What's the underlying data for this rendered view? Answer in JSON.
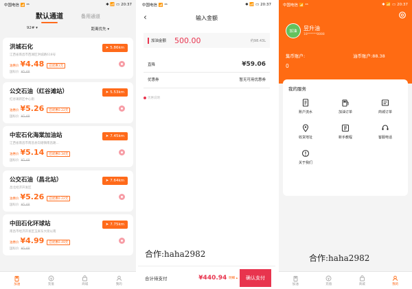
{
  "status_bars": [
    {
      "carrier": "中国电信 📶 ⁴⁶",
      "indicators": "✱ 📶 ▭",
      "time": "20:37"
    },
    {
      "carrier": "中国电信 📶 ⁴⁶",
      "indicators": "✱ 📶 ▭",
      "time": "20:37"
    },
    {
      "carrier": "中国电信 📶 ⁴⁶",
      "indicators": "✱ 📶 ▭",
      "time": "20:37"
    }
  ],
  "list_screen": {
    "tabs": {
      "active": "默认通道",
      "inactive": "备用通道"
    },
    "filters": {
      "fuel": "92# ▾",
      "sort": "距离优先 ▾"
    },
    "stations": [
      {
        "name": "洪城石化",
        "address": "江西省南昌市西湖区洪城路618号",
        "price_label": "油惠价",
        "price": "¥4.48",
        "saved": "已优惠1元",
        "national_label": "国标价",
        "national_price": "¥5.48",
        "distance": "5.86km"
      },
      {
        "name": "公交石油（红谷滩站）",
        "address": "红谷滩新区中心街",
        "price_label": "油惠价",
        "price": "¥5.26",
        "saved": "已优惠0.22元",
        "national_label": "国标价",
        "national_price": "¥5.48",
        "distance": "5.53km"
      },
      {
        "name": "中宏石化海棠加油站",
        "address": "江西省南昌市南昌县向塘镇南昌路...",
        "price_label": "油惠价",
        "price": "¥5.14",
        "saved": "已优惠0.34元",
        "national_label": "国标价",
        "national_price": "¥5.48",
        "distance": "7.45km"
      },
      {
        "name": "公交石油（昌北站）",
        "address": "昌北经济开发区",
        "price_label": "油惠价",
        "price": "¥5.26",
        "saved": "已优惠0.22元",
        "national_label": "国标价",
        "national_price": "¥5.48",
        "distance": "7.64km"
      },
      {
        "name": "中田石化环球站",
        "address": "南昌市经济开发区玉屏东大街以南",
        "price_label": "油惠价",
        "price": "¥4.99",
        "saved": "已优惠0.49元",
        "national_label": "国标价",
        "national_price": "¥5.48",
        "distance": "7.75km"
      }
    ],
    "tabbar": [
      {
        "label": "加油",
        "icon": "fuel-icon",
        "active": true
      },
      {
        "label": "充值",
        "icon": "recharge-icon",
        "active": false
      },
      {
        "label": "商城",
        "icon": "mall-icon",
        "active": false
      },
      {
        "label": "我的",
        "icon": "profile-icon",
        "active": false
      }
    ]
  },
  "amount_screen": {
    "title": "输入金额",
    "back_icon": "back-icon",
    "amount_label": "加油金额",
    "amount_value": "500.00",
    "liters": "约98.43L",
    "discount_label": "直降",
    "discount_value": "¥59.06",
    "coupon_label": "优惠券",
    "coupon_value": "暂无可用优惠券",
    "tip": "优惠说明",
    "watermark": "合作:haha2982",
    "total_label": "合计待支付",
    "total_amount": "¥440.94",
    "total_detail": "明细 ▴",
    "confirm_label": "确认支付"
  },
  "profile_screen": {
    "avatar_text": "加油",
    "name": "昱升油",
    "phone": "18******8888",
    "account_label": "集币账户:",
    "account_value": "0",
    "oil_label": "油币账户:88.38",
    "services_title": "我的服务",
    "services": [
      {
        "label": "账户流水",
        "icon": "account-flow-icon"
      },
      {
        "label": "加油订单",
        "icon": "fuel-order-icon"
      },
      {
        "label": "商城订单",
        "icon": "mall-order-icon"
      },
      {
        "label": "收货地址",
        "icon": "address-icon"
      },
      {
        "label": "新手教程",
        "icon": "tutorial-icon"
      },
      {
        "label": "客服电话",
        "icon": "support-icon"
      },
      {
        "label": "关于我们",
        "icon": "about-icon"
      }
    ],
    "watermark": "合作:haha2982",
    "tabbar": [
      {
        "label": "加油",
        "icon": "fuel-icon",
        "active": false
      },
      {
        "label": "充值",
        "icon": "recharge-icon",
        "active": false
      },
      {
        "label": "商城",
        "icon": "mall-icon",
        "active": false
      },
      {
        "label": "我的",
        "icon": "profile-icon",
        "active": true
      }
    ]
  },
  "colors": {
    "brand_orange": "#ff6b13",
    "accent_red": "#e8344e",
    "pin_pink": "#f79da6"
  }
}
